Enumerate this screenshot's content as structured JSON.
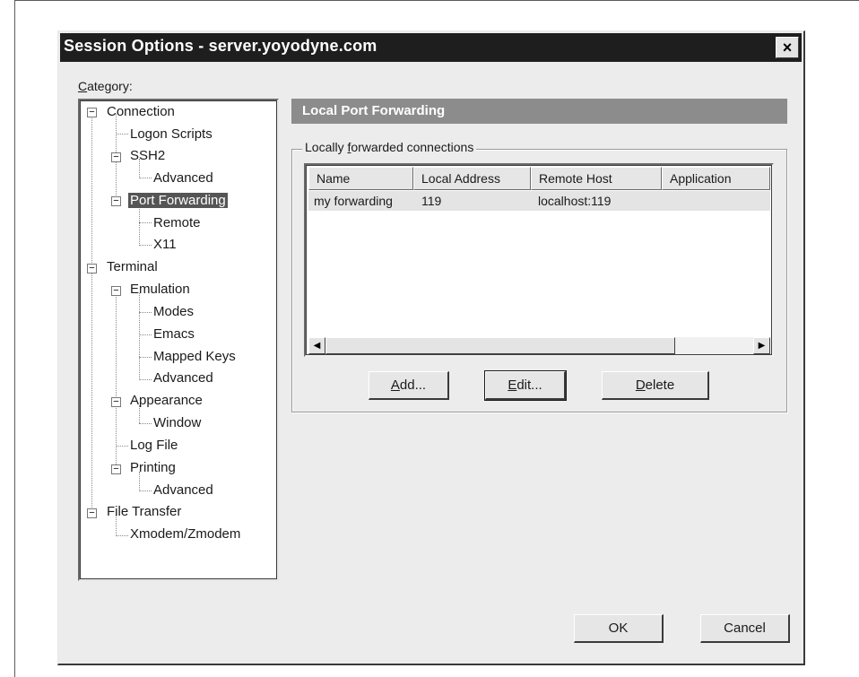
{
  "dialog": {
    "title": "Session Options - server.yoyodyne.com",
    "close_label": "×"
  },
  "category": {
    "label_accel": "C",
    "label_rest": "ategory:"
  },
  "tree": {
    "items": [
      {
        "label": "Connection",
        "expanded": true
      },
      {
        "label": "Logon Scripts"
      },
      {
        "label": "SSH2",
        "expanded": true
      },
      {
        "label": "Advanced"
      },
      {
        "label": "Port Forwarding",
        "expanded": true,
        "selected": true
      },
      {
        "label": "Remote"
      },
      {
        "label": "X11"
      },
      {
        "label": "Terminal",
        "expanded": true
      },
      {
        "label": "Emulation",
        "expanded": true
      },
      {
        "label": "Modes"
      },
      {
        "label": "Emacs"
      },
      {
        "label": "Mapped Keys"
      },
      {
        "label": "Advanced"
      },
      {
        "label": "Appearance",
        "expanded": true
      },
      {
        "label": "Window"
      },
      {
        "label": "Log File"
      },
      {
        "label": "Printing",
        "expanded": true
      },
      {
        "label": "Advanced"
      },
      {
        "label": "File Transfer",
        "expanded": true
      },
      {
        "label": "Xmodem/Zmodem"
      }
    ]
  },
  "panel": {
    "header": "Local Port Forwarding",
    "group_prefix": "Locally ",
    "group_accel": "f",
    "group_rest": "orwarded connections",
    "columns": [
      "Name",
      "Local Address",
      "Remote Host",
      "Application"
    ],
    "rows": [
      {
        "name": "my forwarding",
        "local_address": "119",
        "remote_host": "localhost:119",
        "application": ""
      }
    ],
    "scroll_left": "◀",
    "scroll_right": "▶",
    "buttons": {
      "add_accel": "A",
      "add_rest": "dd...",
      "edit_accel": "E",
      "edit_rest": "dit...",
      "delete_accel": "D",
      "delete_rest": "elete"
    }
  },
  "footer": {
    "ok_label": "OK",
    "cancel_label": "Cancel"
  },
  "tree_toggle_symbol": "−"
}
